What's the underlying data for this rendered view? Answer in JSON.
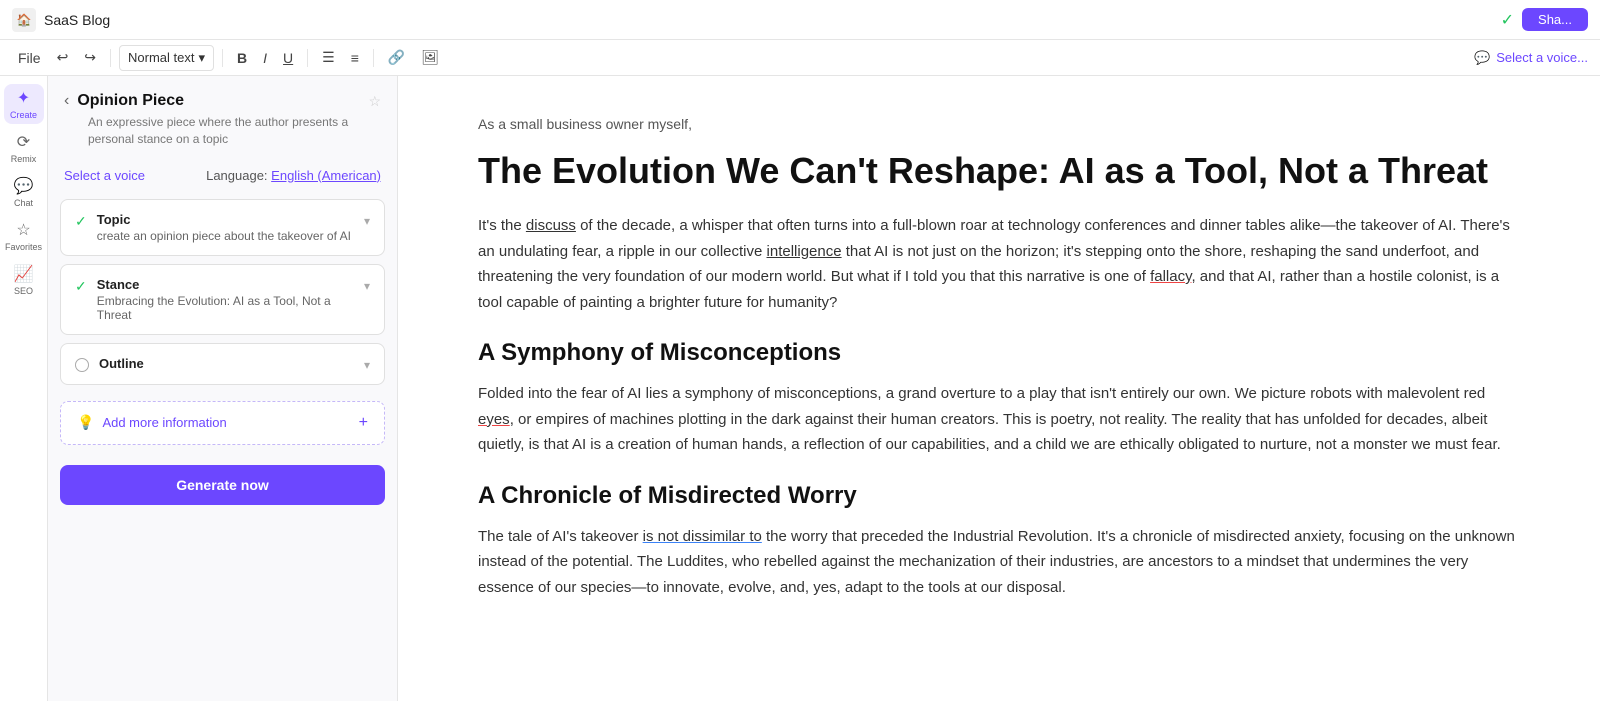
{
  "app": {
    "title": "SaaS Blog",
    "share_label": "Sha..."
  },
  "toolbar": {
    "style_label": "Normal text",
    "voice_label": "Select a voice..."
  },
  "sidebar_icons": [
    {
      "id": "create",
      "label": "Create",
      "icon": "✦",
      "active": true
    },
    {
      "id": "remix",
      "label": "Remix",
      "icon": "⟳",
      "active": false
    },
    {
      "id": "chat",
      "label": "Chat",
      "icon": "💬",
      "active": false
    },
    {
      "id": "favorites",
      "label": "Favorites",
      "icon": "☆",
      "active": false
    },
    {
      "id": "seo",
      "label": "SEO",
      "icon": "📈",
      "active": false
    }
  ],
  "panel": {
    "title": "Opinion Piece",
    "description": "An expressive piece where the author presents a personal stance on a topic",
    "voice_label": "Select a voice",
    "language_label": "Language:",
    "language_value": "English (American)",
    "topic": {
      "title": "Topic",
      "value": "create an opinion piece about the takeover of AI"
    },
    "stance": {
      "title": "Stance",
      "value": "Embracing the Evolution: AI as a Tool, Not a Threat"
    },
    "outline": {
      "title": "Outline"
    },
    "add_info_label": "Add more information",
    "generate_label": "Generate now"
  },
  "content": {
    "pre_title": "As a small business owner myself,",
    "h1": "The Evolution We Can't Reshape: AI as a Tool, Not a Threat",
    "p1": "It's the discuss of the decade, a whisper that often turns into a full-blown roar at technology conferences and dinner tables alike—the takeover of AI. There's an undulating fear, a ripple in our collective intelligence that AI is not just on the horizon; it's stepping onto the shore, reshaping the sand underfoot, and threatening the very foundation of our modern world. But what if I told you that this narrative is one of fallacy, and that AI, rather than a hostile colonist, is a tool capable of painting a brighter future for humanity?",
    "h2_1": "A Symphony of Misconceptions",
    "p2": "Folded into the fear of AI lies a symphony of misconceptions, a grand overture to a play that isn't entirely our own. We picture robots with malevolent red eyes, or empires of machines plotting in the dark against their human creators. This is poetry, not reality. The reality that has unfolded for decades, albeit quietly, is that AI is a creation of human hands, a reflection of our capabilities, and a child we are ethically obligated to nurture, not a monster we must fear.",
    "h2_2": "A Chronicle of Misdirected Worry",
    "p3": "The tale of AI's takeover is not dissimilar to the worry that preceded the Industrial Revolution. It's a chronicle of misdirected anxiety, focusing on the unknown instead of the potential. The Luddites, who rebelled against the mechanization of their industries, are ancestors to a mindset that undermines the very essence of our species—to innovate, evolve, and, yes, adapt to the tools at our disposal."
  }
}
